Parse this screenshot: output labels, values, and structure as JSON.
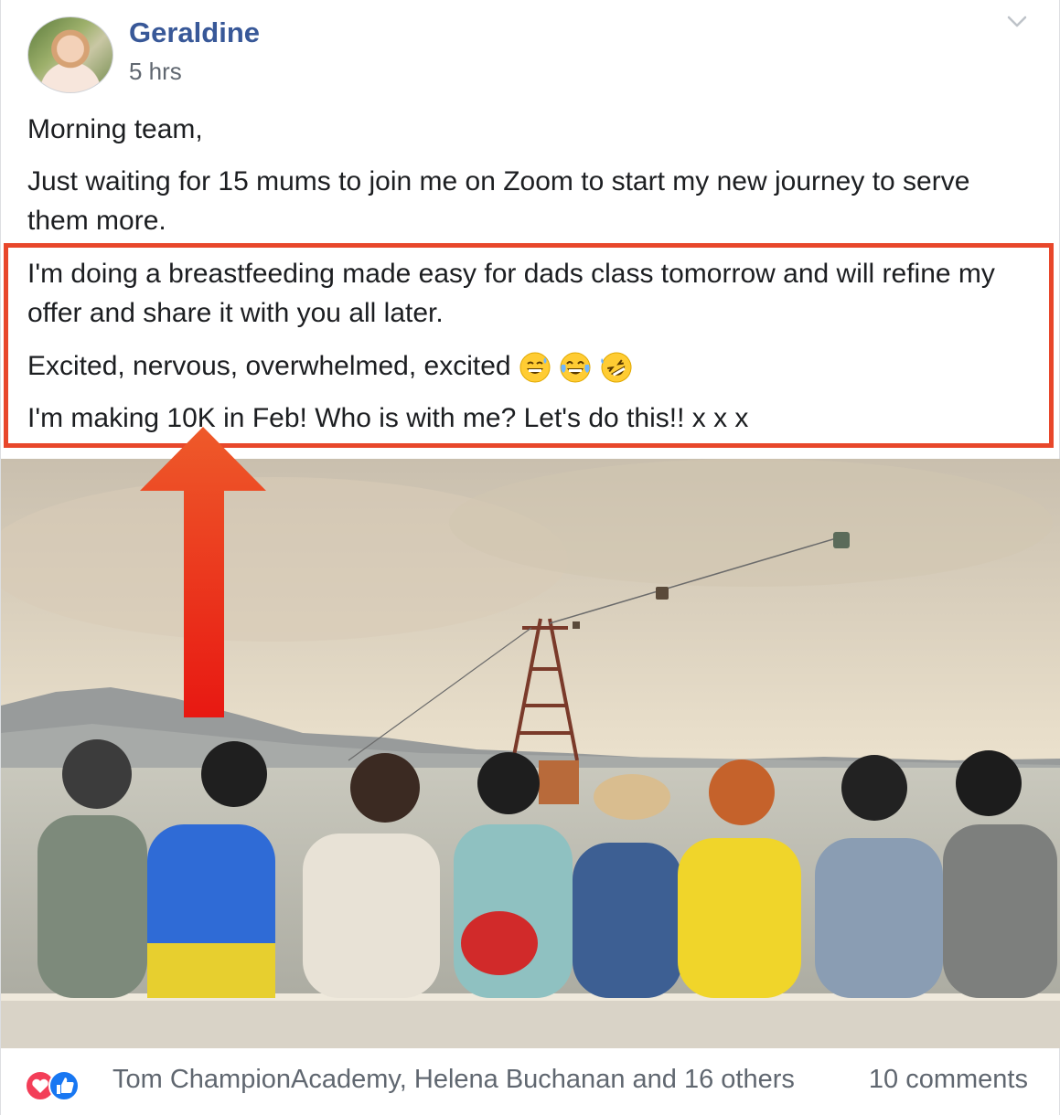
{
  "post": {
    "author": "Geraldine",
    "time": "5 hrs",
    "paragraphs": [
      "Morning team,",
      "Just waiting for 15 mums to join me on Zoom to start my new journey to serve them more.",
      "I'm doing a breastfeeding made easy for dads class tomorrow and will refine my offer and share it with you all later.",
      "Excited, nervous, overwhelmed, excited",
      "I'm making 10K in Feb! Who is with me? Let's do this!! x x x"
    ],
    "emojis": [
      "grinning-sweat-emoji",
      "tears-of-joy-emoji",
      "rolling-laughing-emoji"
    ]
  },
  "footer": {
    "reactors": "Tom ChampionAcademy, Helena Buchanan and 16 others",
    "comments": "10 comments"
  },
  "colors": {
    "author": "#385898",
    "highlight": "#e8472b",
    "arrow": "#e8301c",
    "love": "#f33e58",
    "like": "#1877f2"
  }
}
